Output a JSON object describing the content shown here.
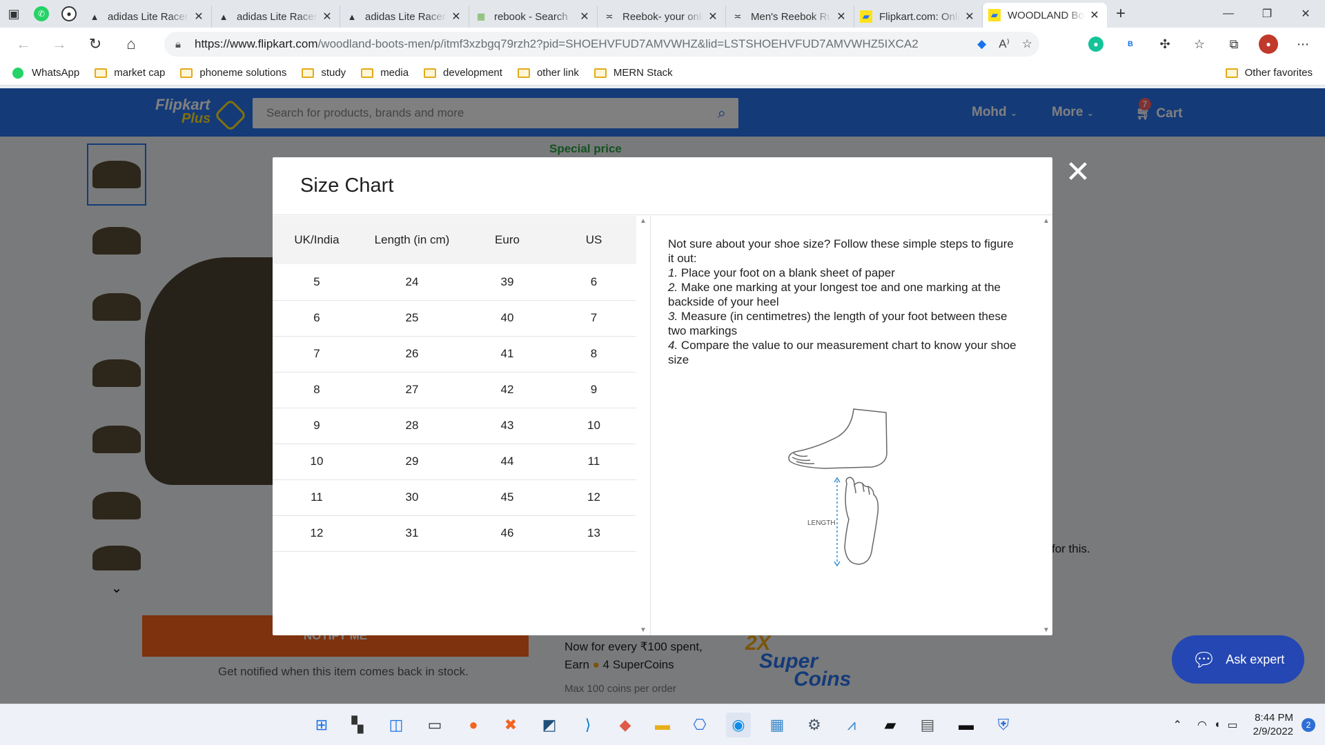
{
  "browser": {
    "tabs": [
      {
        "title": "adidas Lite Racer",
        "icon": "adidas-icon"
      },
      {
        "title": "adidas Lite Racer",
        "icon": "adidas-icon"
      },
      {
        "title": "adidas Lite Racer",
        "icon": "adidas-icon"
      },
      {
        "title": "rebook - Search",
        "icon": "bing-icon"
      },
      {
        "title": "Reebok- your online store",
        "icon": "reebok-icon"
      },
      {
        "title": "Men's Reebok Running Shoes",
        "icon": "reebok-icon"
      },
      {
        "title": "Flipkart.com: Online Shopping",
        "icon": "flipkart-icon"
      },
      {
        "title": "WOODLAND Boots for Men",
        "icon": "flipkart-icon",
        "active": true
      }
    ],
    "url_host": "https://www.flipkart.com",
    "url_path": "/woodland-boots-men/p/itmf3xzbgq79rzh2?pid=SHOEHVFUD7AMVWHZ&lid=LSTSHOEHVFUD7AMVWHZ5IXCA2",
    "extension_badge": "B",
    "bookmarks": [
      "WhatsApp",
      "market cap",
      "phoneme solutions",
      "study",
      "media",
      "development",
      "other link",
      "MERN Stack"
    ],
    "other_favorites": "Other favorites"
  },
  "header": {
    "logo_top": "Flipkart",
    "logo_bottom": "Plus",
    "search_placeholder": "Search for products, brands and more",
    "user": "Mohd",
    "more": "More",
    "cart": "Cart",
    "cart_count": "7"
  },
  "page": {
    "special_price": "Special price",
    "notify_button": "NOTIFY ME",
    "notify_text": "Get notified when this item comes back in stock.",
    "supercoin_line1": "Now for every ₹100 spent,",
    "supercoin_line2_prefix": "Earn",
    "supercoin_line2_suffix": "4 SuperCoins",
    "supercoin_line3": "Max 100 coins per order",
    "supercoin_logo_top": "2X",
    "supercoin_logo_mid": "Super",
    "supercoin_logo_bottom": "Coins",
    "partial_text": "for this."
  },
  "ask_expert": "Ask expert",
  "modal": {
    "title": "Size Chart",
    "columns": [
      "UK/India",
      "Length (in cm)",
      "Euro",
      "US"
    ],
    "rows": [
      [
        "5",
        "24",
        "39",
        "6"
      ],
      [
        "6",
        "25",
        "40",
        "7"
      ],
      [
        "7",
        "26",
        "41",
        "8"
      ],
      [
        "8",
        "27",
        "42",
        "9"
      ],
      [
        "9",
        "28",
        "43",
        "10"
      ],
      [
        "10",
        "29",
        "44",
        "11"
      ],
      [
        "11",
        "30",
        "45",
        "12"
      ],
      [
        "12",
        "31",
        "46",
        "13"
      ]
    ],
    "intro": "Not sure about your shoe size? Follow these simple steps to figure it out:",
    "steps": [
      {
        "num": "1.",
        "text": "Place your foot on a blank sheet of paper"
      },
      {
        "num": "2.",
        "text": "Make one marking at your longest toe and one marking at the backside of your heel"
      },
      {
        "num": "3.",
        "text": "Measure (in centimetres) the length of your foot between these two markings"
      },
      {
        "num": "4.",
        "text": "Compare the value to our measurement chart to know your shoe size"
      }
    ],
    "diagram_label": "LENGTH"
  },
  "taskbar": {
    "time": "8:44 PM",
    "date": "2/9/2022",
    "notifications": "2"
  },
  "colors": {
    "flipkart_blue": "#2874f0",
    "notify_orange": "#fb641b",
    "special_green": "#26a541",
    "supercoin_yellow": "#ffe11b"
  }
}
